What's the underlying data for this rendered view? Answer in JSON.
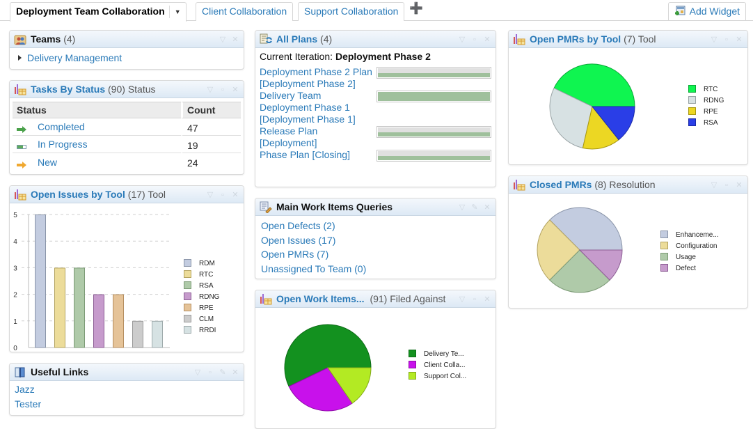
{
  "tabs": {
    "active": "Deployment Team Collaboration",
    "others": [
      "Client Collaboration",
      "Support Collaboration"
    ],
    "add_widget_label": "Add Widget",
    "icons": {
      "dropdown": "chevron-down-icon",
      "add_tab": "plus-icon",
      "add_widget": "add-widget-icon"
    }
  },
  "widgets": {
    "teams": {
      "title": "Teams",
      "count": "(4)",
      "items": [
        "Delivery Management"
      ]
    },
    "tasks": {
      "title": "Tasks By Status",
      "count": "(90)",
      "sub": "Status",
      "columns": [
        "Status",
        "Count"
      ],
      "rows": [
        {
          "status": "Completed",
          "count": "47",
          "icon": "arrow-right-green-icon"
        },
        {
          "status": "In Progress",
          "count": "19",
          "icon": "progress-icon"
        },
        {
          "status": "New",
          "count": "24",
          "icon": "arrow-right-orange-icon"
        }
      ]
    },
    "issues": {
      "title": "Open Issues by Tool",
      "count": "(17)",
      "sub": "Tool"
    },
    "links": {
      "title": "Useful Links",
      "items": [
        "Jazz",
        "Tester"
      ]
    },
    "plans": {
      "title": "All Plans",
      "count": "(4)",
      "current_label": "Current Iteration:",
      "current_value": "Deployment Phase 2",
      "items": [
        {
          "name": "Deployment Phase 2 Plan [Deployment Phase 2]",
          "work_done": 1.0,
          "time_elapsed": 0.0
        },
        {
          "name": "Delivery Team Deployment Phase 1 [Deployment Phase 1]",
          "work_done": 1.0,
          "time_elapsed": 1.0
        },
        {
          "name": "Release Plan [Deployment]",
          "work_done": 1.0,
          "time_elapsed": 0.0
        },
        {
          "name": "Phase Plan [Closing]",
          "work_done": 1.0,
          "time_elapsed": 0.0
        }
      ]
    },
    "queries": {
      "title": "Main Work Items Queries",
      "items": [
        "Open Defects (2)",
        "Open Issues (17)",
        "Open PMRs (7)",
        "Unassigned To Team (0)"
      ]
    },
    "open_work_items": {
      "title": "Open Work Items...",
      "count": "(91)",
      "sub": "Filed Against"
    },
    "open_pmrs": {
      "title": "Open PMRs by Tool",
      "count": "(7)",
      "sub": "Tool"
    },
    "closed_pmrs": {
      "title": "Closed PMRs",
      "count": "(8)",
      "sub": "Resolution"
    }
  },
  "chart_data": [
    {
      "id": "open-issues-by-tool",
      "type": "bar",
      "title": "Open Issues by Tool",
      "categories": [
        "RDM",
        "RTC",
        "RSA",
        "RDNG",
        "RPE",
        "CLM",
        "RRDI"
      ],
      "values": [
        5,
        3,
        3,
        2,
        2,
        1,
        1
      ],
      "colors": [
        "#c3cce0",
        "#ecdc9a",
        "#afcaa9",
        "#c69bcc",
        "#e5c398",
        "#cccccc",
        "#d6e2e3"
      ],
      "strokes": [
        "#8994a8",
        "#b3a360",
        "#7c9a76",
        "#8c5d94",
        "#b58e60",
        "#999999",
        "#9fabac"
      ],
      "ylim": [
        0,
        5
      ],
      "yticks": [
        "0",
        "1",
        "2",
        "3",
        "4",
        "5"
      ],
      "grid": true,
      "legend": "right"
    },
    {
      "id": "open-work-items",
      "type": "pie",
      "title": "Open Work Items... (91) Filed Against",
      "labels": [
        "Delivery Te...",
        "Client Colla...",
        "Support Col..."
      ],
      "values": [
        52,
        25,
        14
      ],
      "colors": [
        "#13911f",
        "#c811eb",
        "#b3ea23"
      ],
      "strokes": [
        "#0c6a15",
        "#8e0ca7",
        "#82a918"
      ],
      "legend": "right"
    },
    {
      "id": "open-pmrs-by-tool",
      "type": "pie",
      "title": "Open PMRs by Tool (7) Tool",
      "labels": [
        "RTC",
        "RDNG",
        "RPE",
        "RSA"
      ],
      "values": [
        3,
        2,
        1,
        1
      ],
      "colors": [
        "#0ff550",
        "#d7e1e3",
        "#ecd723",
        "#2a3ee7"
      ],
      "strokes": [
        "#0aa838",
        "#9aa4a6",
        "#a89812",
        "#1a2aa8"
      ],
      "legend": "right"
    },
    {
      "id": "closed-pmrs",
      "type": "pie",
      "title": "Closed PMRs (8) Resolution",
      "labels": [
        "Enhanceme...",
        "Configuration",
        "Usage",
        "Defect"
      ],
      "values": [
        3,
        2,
        2,
        1
      ],
      "colors": [
        "#c3cce0",
        "#ecdc9a",
        "#afcaa9",
        "#c69bcc"
      ],
      "strokes": [
        "#8994a8",
        "#b3a360",
        "#7c9a76",
        "#8c5d94"
      ],
      "legend": "right"
    }
  ]
}
